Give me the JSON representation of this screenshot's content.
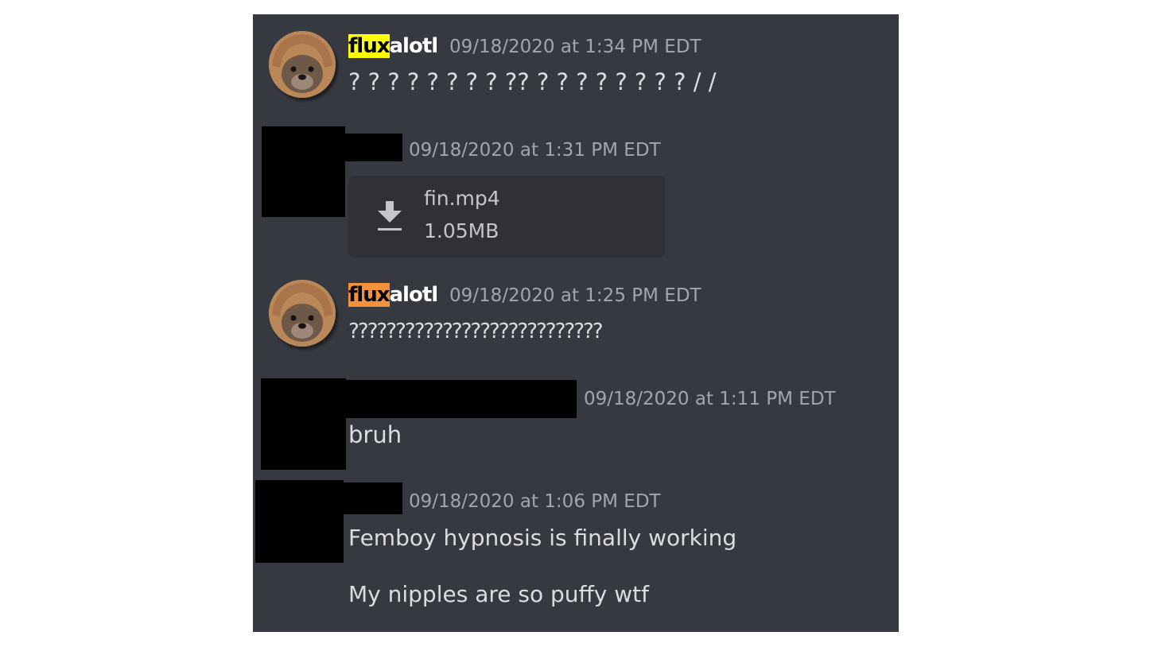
{
  "colors": {
    "background": "#36393f",
    "attachment_bg": "#2f3136",
    "username": "#ffffff",
    "timestamp": "#a3a6aa",
    "message": "#dcddde",
    "highlight_1": "#ffff00",
    "highlight_2": "#f5913a",
    "redaction": "#000000"
  },
  "messages": [
    {
      "author_highlight": "flux",
      "author_rest": "alotl",
      "timestamp": "09/18/2020 at 1:34 PM EDT",
      "text": "? ? ? ? ? ? ? ? ?? ? ? ? ? ? ? ? ? / /"
    },
    {
      "timestamp": "09/18/2020 at 1:31 PM EDT",
      "attachment": {
        "icon": "download-icon",
        "filename": "fin.mp4",
        "size": "1.05MB"
      }
    },
    {
      "author_highlight": "flux",
      "author_rest": "alotl",
      "timestamp": "09/18/2020 at 1:25 PM EDT",
      "text": "???????????????????????????"
    },
    {
      "timestamp": "09/18/2020 at 1:11 PM EDT",
      "text": "bruh"
    },
    {
      "timestamp": "09/18/2020 at 1:06 PM EDT",
      "lines": [
        "Femboy hypnosis is finally working",
        "My nipples are so puffy wtf"
      ]
    }
  ]
}
